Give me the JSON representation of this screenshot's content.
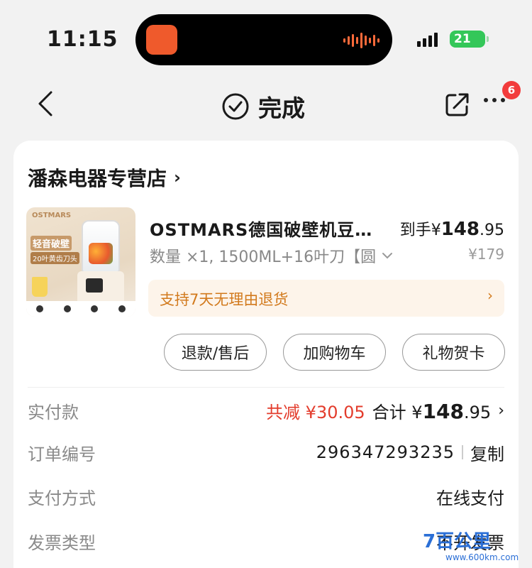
{
  "status": {
    "time": "11:15",
    "battery": "21"
  },
  "nav": {
    "title": "完成",
    "badge": "6"
  },
  "store": {
    "name": "潘森电器专营店"
  },
  "product": {
    "thumb_brand": "OSTMARS",
    "thumb_line1": "轻音破壁",
    "thumb_line2": "20叶黄齿刀头",
    "name": "OSTMARS德国破壁机豆…",
    "price_prefix": "到手¥",
    "price_int": "148",
    "price_dec": ".95",
    "spec": "数量 ×1, 1500ML+16叶刀【圆",
    "original_price": "¥179",
    "refund_tip": "支持7天无理由退货"
  },
  "actions": {
    "refund": "退款/售后",
    "add_cart": "加购物车",
    "gift_card": "礼物贺卡"
  },
  "details": {
    "paid_label": "实付款",
    "reduction": "共减 ¥30.05",
    "total_prefix": "合计 ¥",
    "total_int": "148",
    "total_dec": ".95",
    "order_label": "订单编号",
    "order_no": "296347293235",
    "copy": "复制",
    "pay_label": "支付方式",
    "pay_value": "在线支付",
    "invoice_label": "发票类型",
    "invoice_value": "不开发票"
  },
  "watermark": {
    "text": "7百公里",
    "url": "www.600km.com"
  },
  "colors": {
    "accent": "#e33c2c",
    "refund_tip": "#d27a1d",
    "refund_bg": "#fdf4ea",
    "badge": "#f23c3c"
  }
}
